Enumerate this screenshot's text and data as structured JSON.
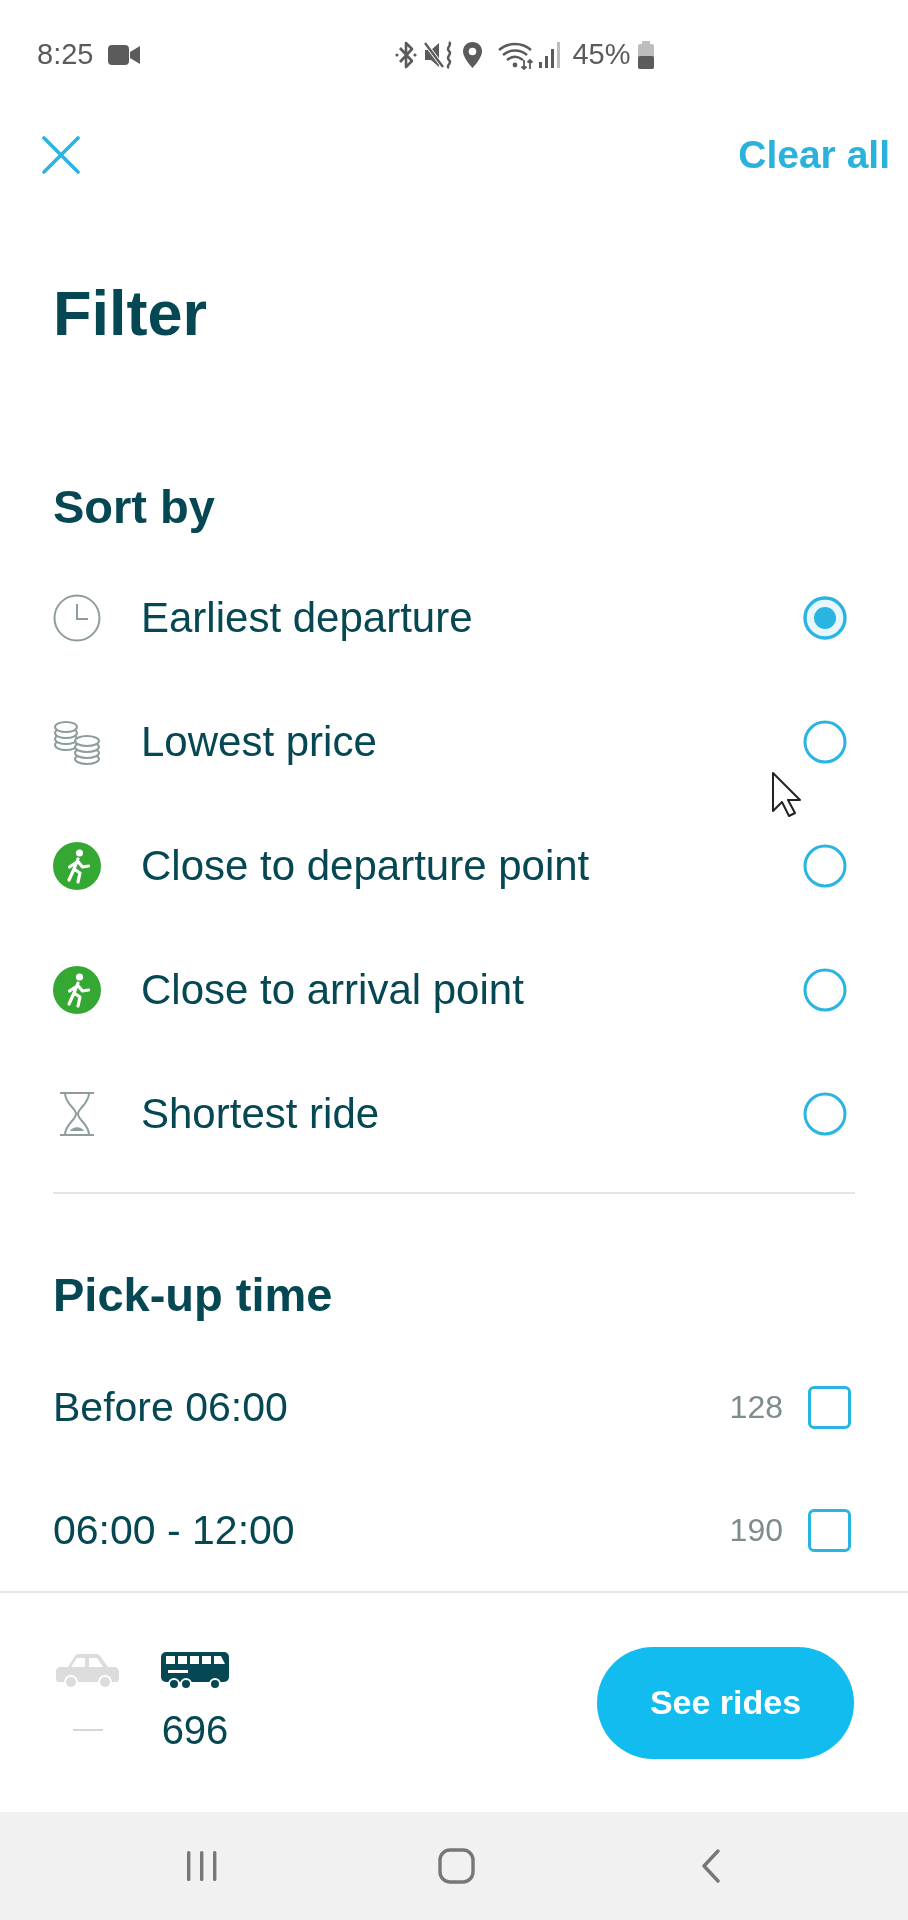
{
  "status_bar": {
    "time": "8:25",
    "battery": "45%"
  },
  "header": {
    "clear_label": "Clear all"
  },
  "title": "Filter",
  "sort": {
    "heading": "Sort by",
    "options": [
      {
        "kind": "time",
        "label": "Earliest departure",
        "selected": true
      },
      {
        "kind": "price",
        "label": "Lowest price",
        "selected": false
      },
      {
        "kind": "pickup",
        "label": "Close to departure point",
        "selected": false
      },
      {
        "kind": "dropoff",
        "label": "Close to arrival point",
        "selected": false
      },
      {
        "kind": "duration",
        "label": "Shortest ride",
        "selected": false
      }
    ]
  },
  "pickup_time": {
    "heading": "Pick-up time",
    "options": [
      {
        "label": "Before 06:00",
        "count": "128",
        "checked": false
      },
      {
        "label": "06:00 - 12:00",
        "count": "190",
        "checked": false
      }
    ]
  },
  "footer": {
    "modes": [
      {
        "kind": "car",
        "count": "—",
        "disabled": true
      },
      {
        "kind": "bus",
        "count": "696",
        "disabled": false
      }
    ],
    "button": "See rides"
  }
}
